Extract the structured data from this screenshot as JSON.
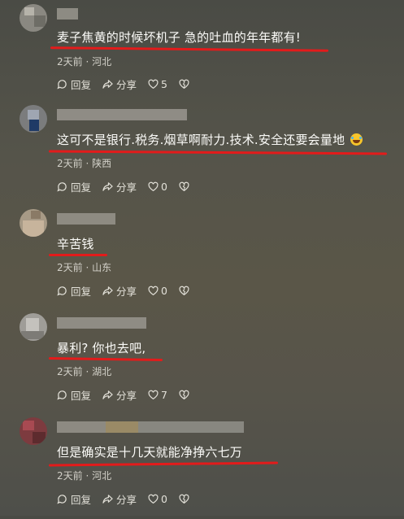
{
  "comments": [
    {
      "text": "麦子焦黄的时候坏机子 急的吐血的年年都有!",
      "time": "2天前",
      "location": "河北",
      "reply_label": "回复",
      "share_label": "分享",
      "like_count": "5",
      "has_emoji": false
    },
    {
      "text": "这可不是银行.税务.烟草啊耐力.技术.安全还要会量地",
      "time": "2天前",
      "location": "陕西",
      "reply_label": "回复",
      "share_label": "分享",
      "like_count": "0",
      "has_emoji": true
    },
    {
      "text": "辛苦钱",
      "time": "2天前",
      "location": "山东",
      "reply_label": "回复",
      "share_label": "分享",
      "like_count": "0",
      "has_emoji": false
    },
    {
      "text": "暴利? 你也去吧,",
      "time": "2天前",
      "location": "湖北",
      "reply_label": "回复",
      "share_label": "分享",
      "like_count": "7",
      "has_emoji": false
    },
    {
      "text": "但是确实是十几天就能净挣六七万",
      "time": "2天前",
      "location": "河北",
      "reply_label": "回复",
      "share_label": "分享",
      "like_count": "0",
      "has_emoji": false
    }
  ],
  "meta_separator": "·",
  "colors": {
    "underline": "#e31b1b",
    "text": "#fbfbf8",
    "meta": "#d2d0c8"
  },
  "icons": [
    "reply-icon",
    "share-icon",
    "heart-icon",
    "dislike-icon",
    "laughing-emoji-icon"
  ]
}
